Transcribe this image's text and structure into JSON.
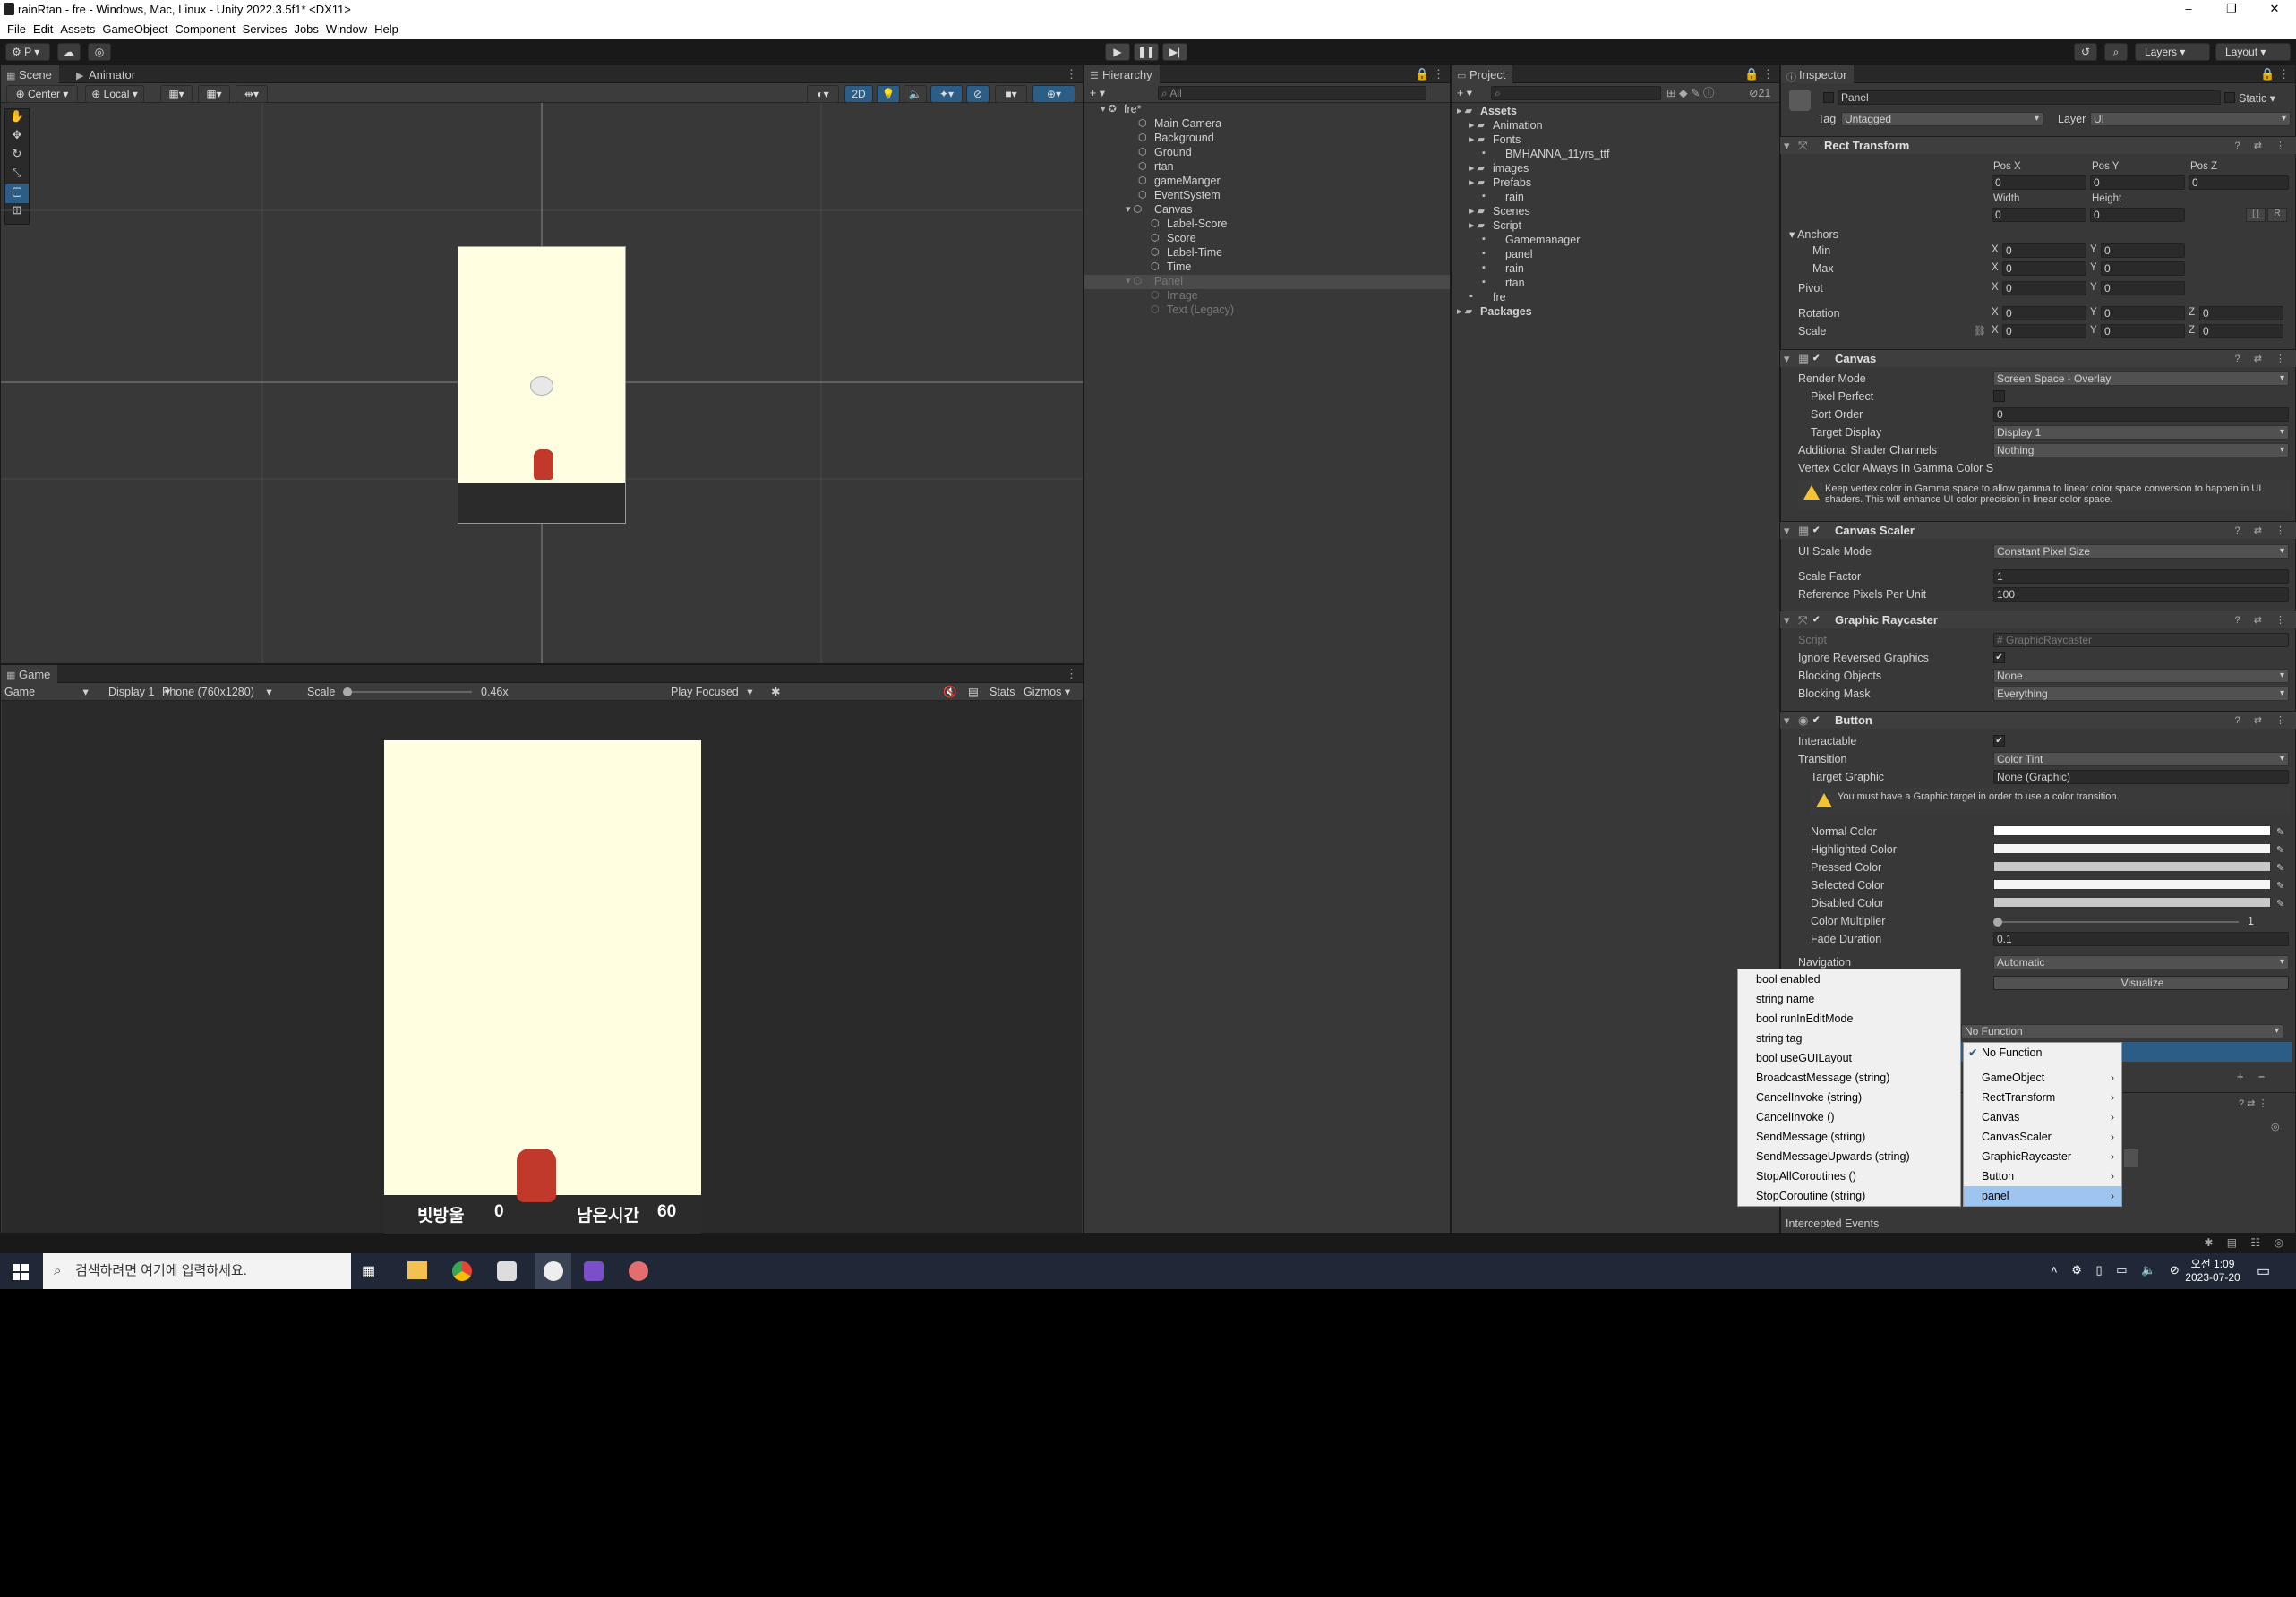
{
  "title": "rainRtan - fre - Windows, Mac, Linux - Unity 2022.3.5f1* <DX11>",
  "window_controls": [
    "–",
    "❐",
    "✕"
  ],
  "menu": [
    "File",
    "Edit",
    "Assets",
    "GameObject",
    "Component",
    "Services",
    "Jobs",
    "Window",
    "Help"
  ],
  "toolbar": {
    "account": "P",
    "layers": "Layers",
    "layout": "Layout"
  },
  "scene": {
    "tabs": [
      "Scene",
      "Animator"
    ],
    "pivot": "Center",
    "space": "Local",
    "mode2d": "2D"
  },
  "game": {
    "tab": "Game",
    "view": "Game",
    "display": "Display 1",
    "resolution": "Phone (760x1280)",
    "scale_label": "Scale",
    "scale_value": "0.46x",
    "play_mode": "Play Focused",
    "mute": "🔇",
    "stats": "Stats",
    "gizmos": "Gizmos",
    "hud_score_label": "빗방울",
    "hud_score": "0",
    "hud_time_label": "남은시간",
    "hud_time": "60"
  },
  "hierarchy": {
    "tab": "Hierarchy",
    "search": "All",
    "items": [
      {
        "label": "fre*",
        "depth": 0,
        "muted": false
      },
      {
        "label": "Main Camera",
        "depth": 1,
        "muted": false
      },
      {
        "label": "Background",
        "depth": 1,
        "muted": false
      },
      {
        "label": "Ground",
        "depth": 1,
        "muted": false
      },
      {
        "label": "rtan",
        "depth": 1,
        "muted": false
      },
      {
        "label": "gameManger",
        "depth": 1,
        "muted": false
      },
      {
        "label": "EventSystem",
        "depth": 1,
        "muted": false
      },
      {
        "label": "Canvas",
        "depth": 1,
        "muted": false
      },
      {
        "label": "Label-Score",
        "depth": 2,
        "muted": false
      },
      {
        "label": "Score",
        "depth": 2,
        "muted": false
      },
      {
        "label": "Label-Time",
        "depth": 2,
        "muted": false
      },
      {
        "label": "Time",
        "depth": 2,
        "muted": false
      },
      {
        "label": "Panel",
        "depth": 1,
        "muted": true
      },
      {
        "label": "Image",
        "depth": 2,
        "muted": true
      },
      {
        "label": "Text (Legacy)",
        "depth": 2,
        "muted": true
      }
    ]
  },
  "project": {
    "tab": "Project",
    "count": "21",
    "items": [
      {
        "label": "Assets",
        "depth": 0,
        "bold": true
      },
      {
        "label": "Animation",
        "depth": 1
      },
      {
        "label": "Fonts",
        "depth": 1
      },
      {
        "label": "BMHANNA_11yrs_ttf",
        "depth": 2
      },
      {
        "label": "images",
        "depth": 1
      },
      {
        "label": "Prefabs",
        "depth": 1
      },
      {
        "label": "rain",
        "depth": 2
      },
      {
        "label": "Scenes",
        "depth": 1
      },
      {
        "label": "Script",
        "depth": 1
      },
      {
        "label": "Gamemanager",
        "depth": 2
      },
      {
        "label": "panel",
        "depth": 2
      },
      {
        "label": "rain",
        "depth": 2
      },
      {
        "label": "rtan",
        "depth": 2
      },
      {
        "label": "fre",
        "depth": 1
      },
      {
        "label": "Packages",
        "depth": 0,
        "bold": true
      }
    ]
  },
  "inspector": {
    "tab": "Inspector",
    "name": "Panel",
    "static": "Static",
    "tag_label": "Tag",
    "tag": "Untagged",
    "layer_label": "Layer",
    "layer": "UI",
    "rect": {
      "title": "Rect Transform",
      "posx_label": "Pos X",
      "posy_label": "Pos Y",
      "posz_label": "Pos Z",
      "posx": "0",
      "posy": "0",
      "posz": "0",
      "width_label": "Width",
      "height_label": "Height",
      "width": "0",
      "height": "0",
      "anchors": "Anchors",
      "min": "Min",
      "max": "Max",
      "pivot": "Pivot",
      "rotation": "Rotation",
      "scale": "Scale",
      "zero": "0",
      "x": "X",
      "y": "Y",
      "z": "Z",
      "r": "R"
    },
    "canvas": {
      "title": "Canvas",
      "render_mode_label": "Render Mode",
      "render_mode": "Screen Space - Overlay",
      "pixel_perfect": "Pixel Perfect",
      "sort_order_label": "Sort Order",
      "sort_order": "0",
      "target_display_label": "Target Display",
      "target_display": "Display 1",
      "shader_channels_label": "Additional Shader Channels",
      "shader_channels": "Nothing",
      "vertex_label": "Vertex Color Always In Gamma Color S",
      "warning": "Keep vertex color in Gamma space to allow gamma to linear color space conversion to happen in UI shaders. This will enhance UI color precision in linear color space."
    },
    "scaler": {
      "title": "Canvas Scaler",
      "mode_label": "UI Scale Mode",
      "mode": "Constant Pixel Size",
      "factor_label": "Scale Factor",
      "factor": "1",
      "ppu_label": "Reference Pixels Per Unit",
      "ppu": "100"
    },
    "raycaster": {
      "title": "Graphic Raycaster",
      "script_label": "Script",
      "script": "GraphicRaycaster",
      "ignore_label": "Ignore Reversed Graphics",
      "blocking_label": "Blocking Objects",
      "blocking": "None",
      "mask_label": "Blocking Mask",
      "mask": "Everything"
    },
    "button": {
      "title": "Button",
      "interactable_label": "Interactable",
      "transition_label": "Transition",
      "transition": "Color Tint",
      "target_label": "Target Graphic",
      "target": "None (Graphic)",
      "warning": "You must have a Graphic target in order to use a color transition.",
      "normal": "Normal Color",
      "highlighted": "Highlighted Color",
      "pressed": "Pressed Color",
      "selected": "Selected Color",
      "disabled": "Disabled Color",
      "multiplier_label": "Color Multiplier",
      "multiplier": "1",
      "fade_label": "Fade Duration",
      "fade": "0.1",
      "navigation_label": "Navigation",
      "navigation": "Automatic",
      "visualize": "Visualize",
      "function": "No Function",
      "plus": "+",
      "minus": "−"
    },
    "intercepted": "Intercepted Events"
  },
  "menu_left": [
    "bool enabled",
    "string name",
    "bool runInEditMode",
    "string tag",
    "bool useGUILayout",
    "BroadcastMessage (string)",
    "CancelInvoke (string)",
    "CancelInvoke ()",
    "SendMessage (string)",
    "SendMessageUpwards (string)",
    "StopAllCoroutines ()",
    "StopCoroutine (string)"
  ],
  "menu_right": [
    "No Function",
    "GameObject",
    "RectTransform",
    "Canvas",
    "CanvasScaler",
    "GraphicRaycaster",
    "Button",
    "panel"
  ],
  "taskbar": {
    "search_placeholder": "검색하려면 여기에 입력하세요.",
    "time": "오전 1:09",
    "date": "2023-07-20"
  },
  "colors": {
    "editor_bg": "#383838",
    "game_bg": "#fffee0",
    "highlight": "#2c5d87"
  }
}
